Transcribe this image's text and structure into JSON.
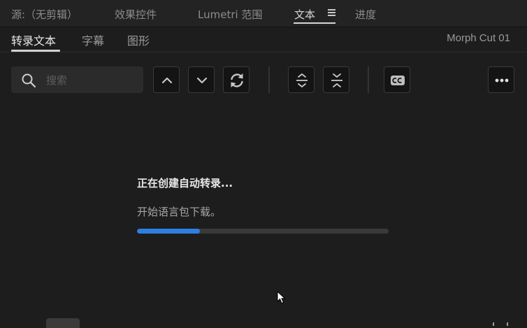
{
  "panel_tabs": [
    {
      "label": "源:（无剪辑）"
    },
    {
      "label": "效果控件"
    },
    {
      "label": "Lumetri 范围"
    },
    {
      "label": "文本"
    },
    {
      "label": "进度"
    }
  ],
  "sub_tabs": [
    {
      "label": "转录文本"
    },
    {
      "label": "字幕"
    },
    {
      "label": "图形"
    }
  ],
  "sequence_name": "Morph Cut 01",
  "search": {
    "placeholder": "搜索",
    "value": ""
  },
  "toolbar": {
    "icons": [
      "search-icon",
      "chevron-up-icon",
      "chevron-down-icon",
      "refresh-icon",
      "expand-icon",
      "collapse-icon",
      "closed-captions-icon",
      "more-icon"
    ]
  },
  "status": {
    "title": "正在创建自动转录...",
    "subtitle": "开始语言包下载。",
    "progress": 0.25
  },
  "colors": {
    "background": "#1d1d1d",
    "accent": "#2f7fe0",
    "text_primary": "#e8e8e8",
    "text_secondary": "#a6a6a6"
  }
}
